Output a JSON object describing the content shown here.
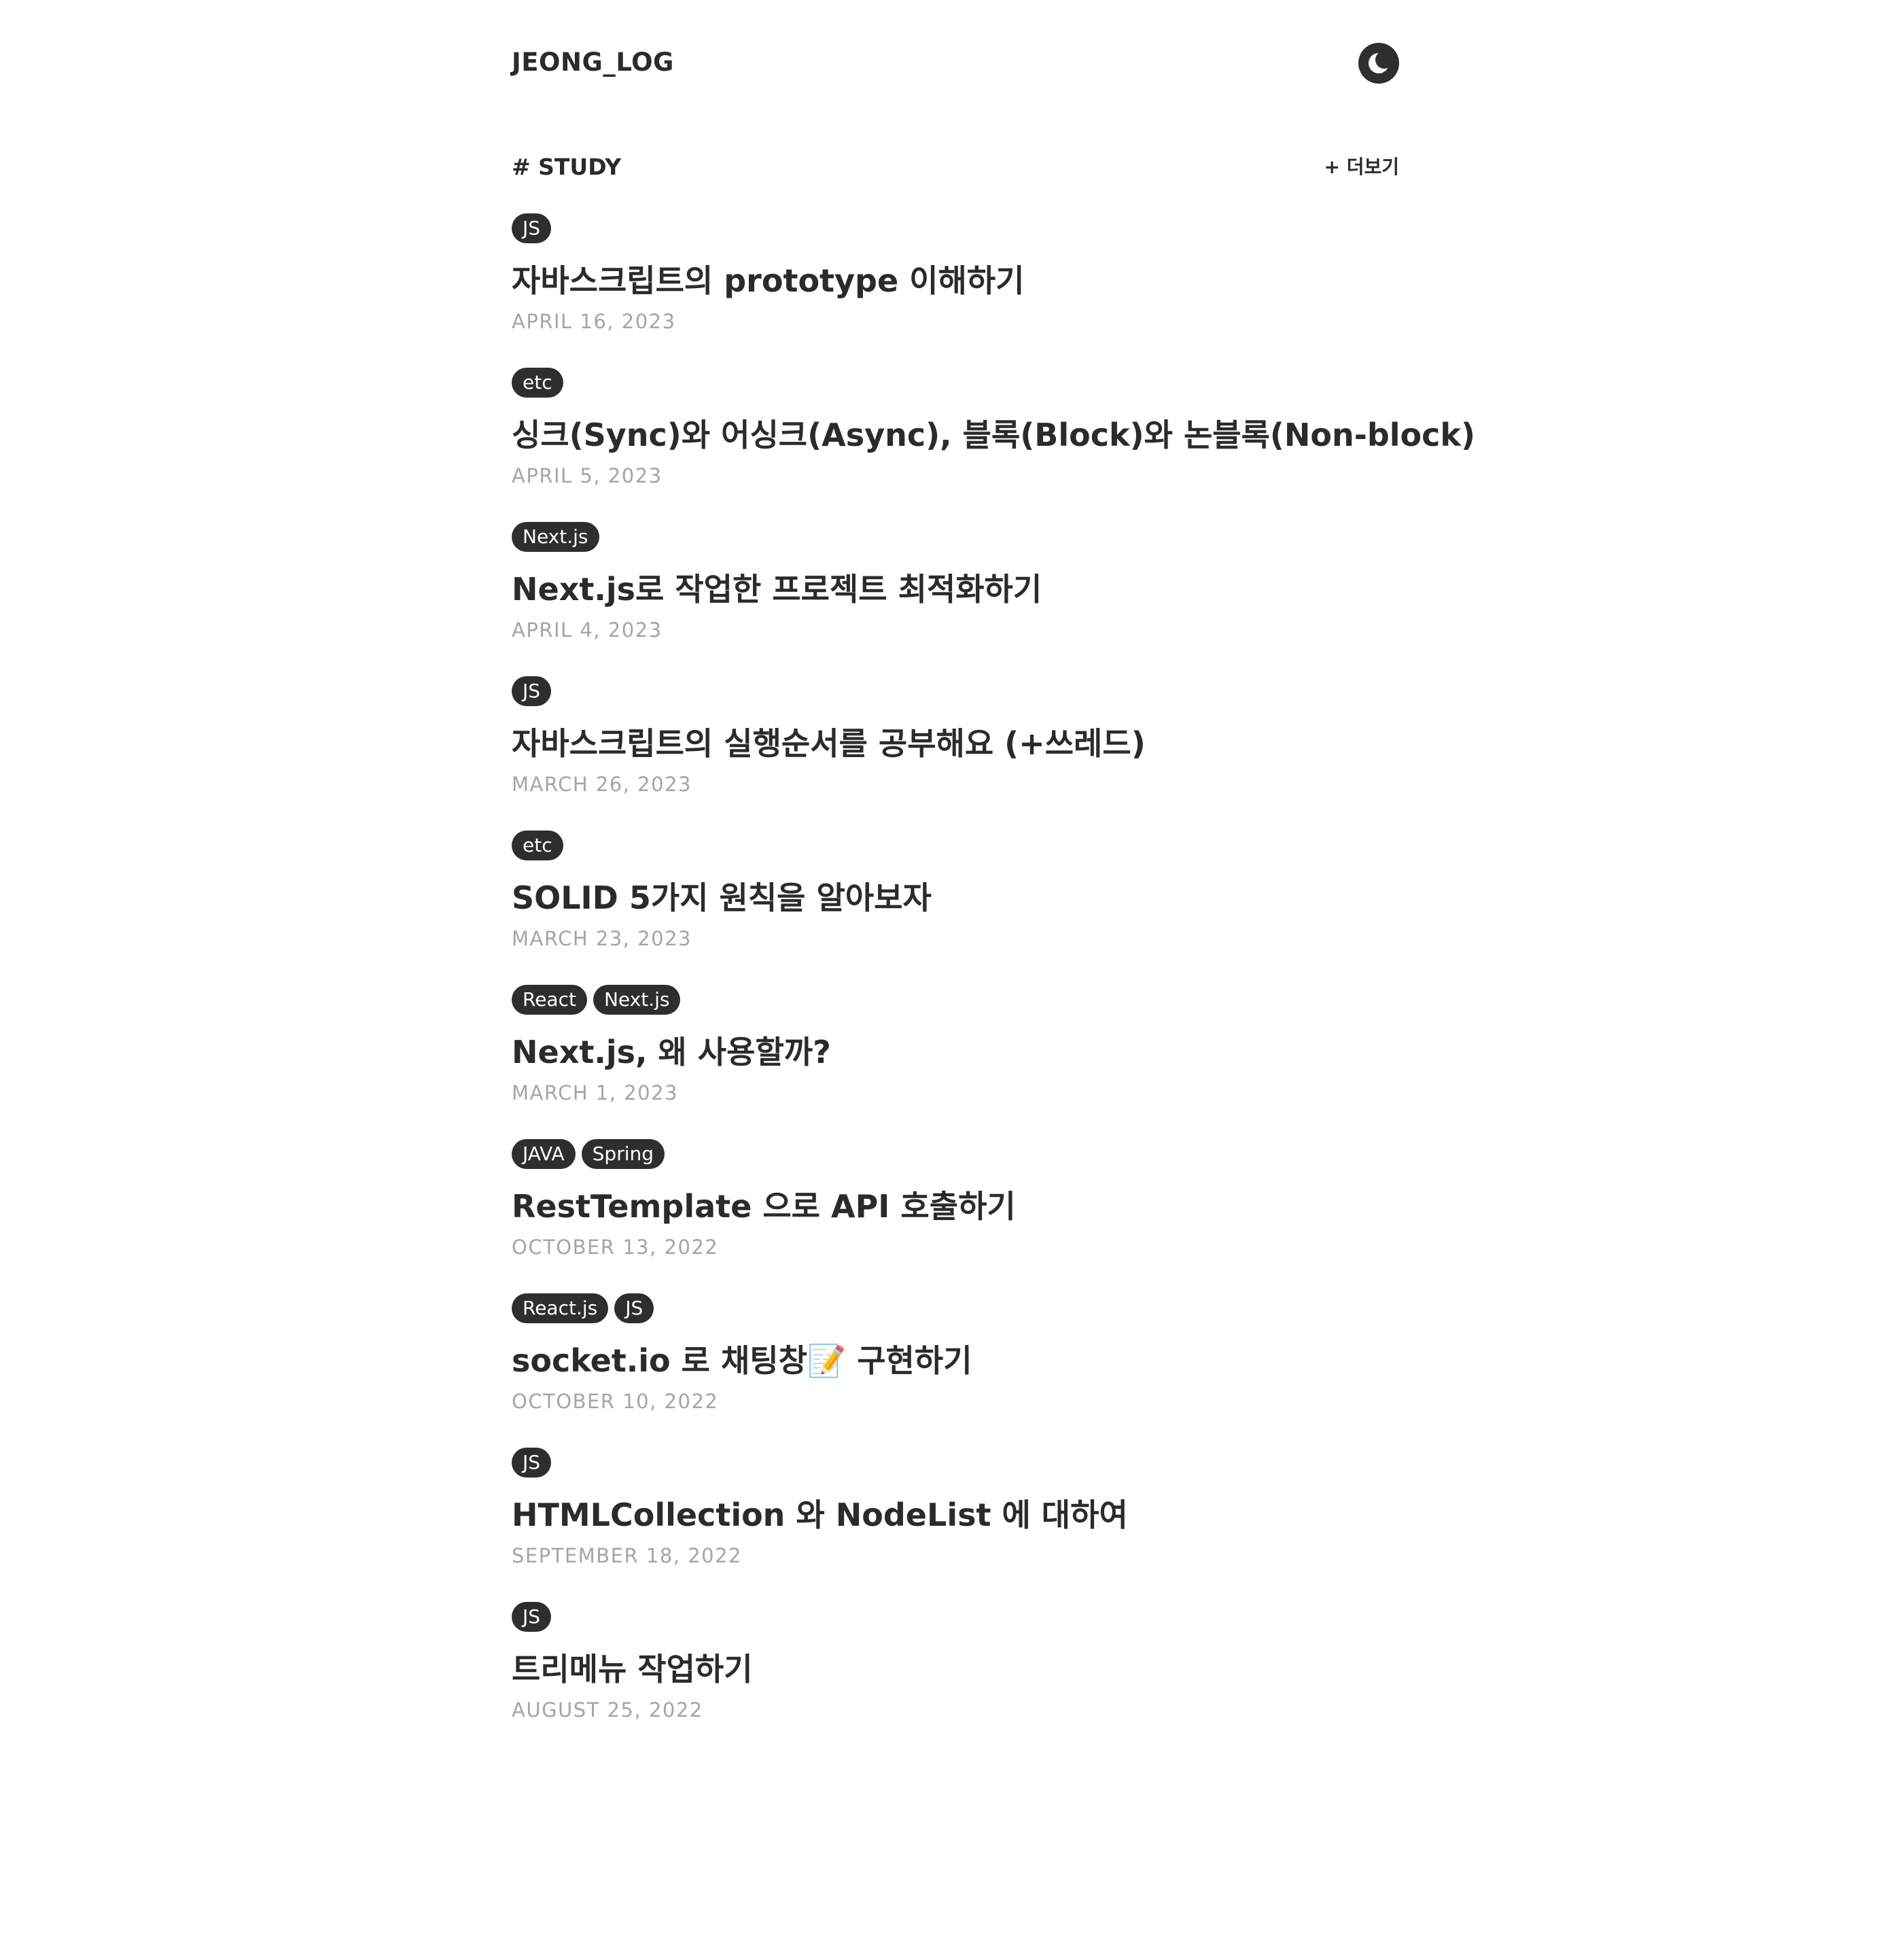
{
  "header": {
    "logo": "JEONG_LOG",
    "theme_icon": "moon-icon"
  },
  "section": {
    "title": "# STUDY",
    "more_label": "+ 더보기"
  },
  "posts": [
    {
      "tags": [
        "JS"
      ],
      "title": "자바스크립트의 prototype 이해하기",
      "date": "APRIL 16, 2023"
    },
    {
      "tags": [
        "etc"
      ],
      "title": "싱크(Sync)와 어싱크(Async), 블록(Block)와 논블록(Non-block)",
      "date": "APRIL 5, 2023"
    },
    {
      "tags": [
        "Next.js"
      ],
      "title": "Next.js로 작업한 프로젝트 최적화하기",
      "date": "APRIL 4, 2023"
    },
    {
      "tags": [
        "JS"
      ],
      "title": "자바스크립트의 실행순서를 공부해요 (+쓰레드)",
      "date": "MARCH 26, 2023"
    },
    {
      "tags": [
        "etc"
      ],
      "title": "SOLID 5가지 원칙을 알아보자",
      "date": "MARCH 23, 2023"
    },
    {
      "tags": [
        "React",
        "Next.js"
      ],
      "title": "Next.js, 왜 사용할까?",
      "date": "MARCH 1, 2023"
    },
    {
      "tags": [
        "JAVA",
        "Spring"
      ],
      "title": "RestTemplate 으로 API 호출하기",
      "date": "OCTOBER 13, 2022"
    },
    {
      "tags": [
        "React.js",
        "JS"
      ],
      "title": "socket.io 로 채팅창📝 구현하기",
      "date": "OCTOBER 10, 2022"
    },
    {
      "tags": [
        "JS"
      ],
      "title": "HTMLCollection 와 NodeList 에 대하여",
      "date": "SEPTEMBER 18, 2022"
    },
    {
      "tags": [
        "JS"
      ],
      "title": "트리메뉴 작업하기",
      "date": "AUGUST 25, 2022"
    }
  ]
}
